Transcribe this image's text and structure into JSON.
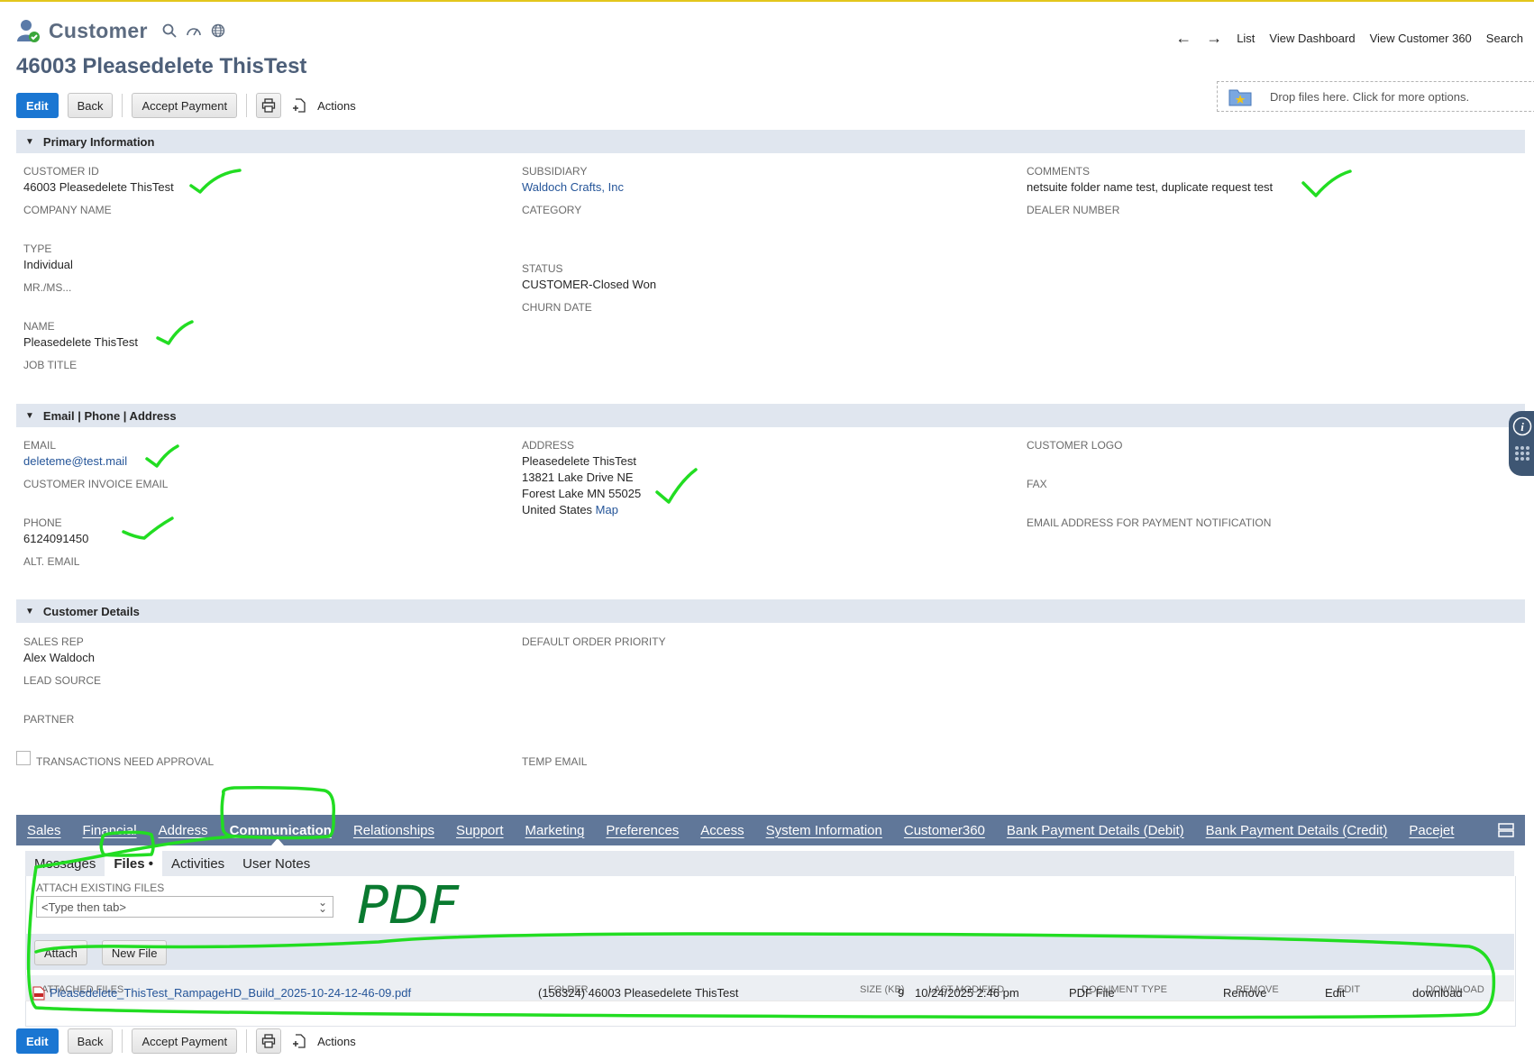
{
  "header": {
    "record_type": "Customer",
    "title": "46003 Pleasedelete ThisTest",
    "nav": {
      "list": "List",
      "view_dashboard": "View Dashboard",
      "view_customer360": "View Customer 360",
      "search": "Search"
    }
  },
  "buttons": {
    "edit": "Edit",
    "back": "Back",
    "accept_payment": "Accept Payment",
    "actions": "Actions"
  },
  "dropzone": "Drop files here. Click for more options.",
  "primary": {
    "title": "Primary Information",
    "customer_id_label": "CUSTOMER ID",
    "customer_id": "46003 Pleasedelete ThisTest",
    "company_name_label": "COMPANY NAME",
    "type_label": "TYPE",
    "type": "Individual",
    "mrms_label": "MR./MS...",
    "name_label": "NAME",
    "name": "Pleasedelete ThisTest",
    "job_title_label": "JOB TITLE",
    "subsidiary_label": "SUBSIDIARY",
    "subsidiary": "Waldoch Crafts, Inc",
    "category_label": "CATEGORY",
    "status_label": "STATUS",
    "status": "CUSTOMER-Closed Won",
    "churn_label": "CHURN DATE",
    "comments_label": "COMMENTS",
    "comments": "netsuite folder name test, duplicate request test",
    "dealer_label": "DEALER NUMBER"
  },
  "contact": {
    "title": "Email | Phone | Address",
    "email_label": "EMAIL",
    "email": "deleteme@test.mail",
    "invoice_email_label": "CUSTOMER INVOICE EMAIL",
    "phone_label": "PHONE",
    "phone": "6124091450",
    "alt_email_label": "ALT. EMAIL",
    "address_label": "ADDRESS",
    "address_line1": "Pleasedelete ThisTest",
    "address_line2": "13821 Lake Drive NE",
    "address_line3": "Forest Lake MN 55025",
    "address_line4": "United States",
    "map": "Map",
    "logo_label": "CUSTOMER LOGO",
    "fax_label": "FAX",
    "payment_email_label": "EMAIL ADDRESS FOR PAYMENT NOTIFICATION"
  },
  "details": {
    "title": "Customer Details",
    "sales_rep_label": "SALES REP",
    "sales_rep": "Alex Waldoch",
    "lead_source_label": "LEAD SOURCE",
    "partner_label": "PARTNER",
    "tx_approval_label": "TRANSACTIONS NEED APPROVAL",
    "order_priority_label": "DEFAULT ORDER PRIORITY",
    "temp_email_label": "TEMP EMAIL"
  },
  "tabs": [
    "Sales",
    "Financial",
    "Address",
    "Communication",
    "Relationships",
    "Support",
    "Marketing",
    "Preferences",
    "Access",
    "System Information",
    "Customer360",
    "Bank Payment Details (Debit)",
    "Bank Payment Details (Credit)",
    "Pacejet"
  ],
  "subtabs": [
    "Messages",
    "Files •",
    "Activities",
    "User Notes"
  ],
  "files": {
    "attach_label": "ATTACH EXISTING FILES",
    "attach_placeholder": "<Type then tab>",
    "attach_button": "Attach",
    "new_file_button": "New File",
    "columns": [
      "ATTACHED FILES",
      "FOLDER",
      "SIZE (KB)",
      "LAST MODIFIED",
      "DOCUMENT TYPE",
      "REMOVE",
      "EDIT",
      "DOWNLOAD"
    ],
    "row": {
      "name": "Pleasedelete_ThisTest_RampageHD_Build_2025-10-24-12-46-09.pdf",
      "folder": "(156324) 46003 Pleasedelete ThisTest",
      "size": "9",
      "modified": "10/24/2025 2:46 pm",
      "doc_type": "PDF File",
      "remove": "Remove",
      "edit": "Edit",
      "download": "download"
    }
  },
  "annotation": {
    "pdf_text": "PDF",
    "color": "#22dd22"
  }
}
